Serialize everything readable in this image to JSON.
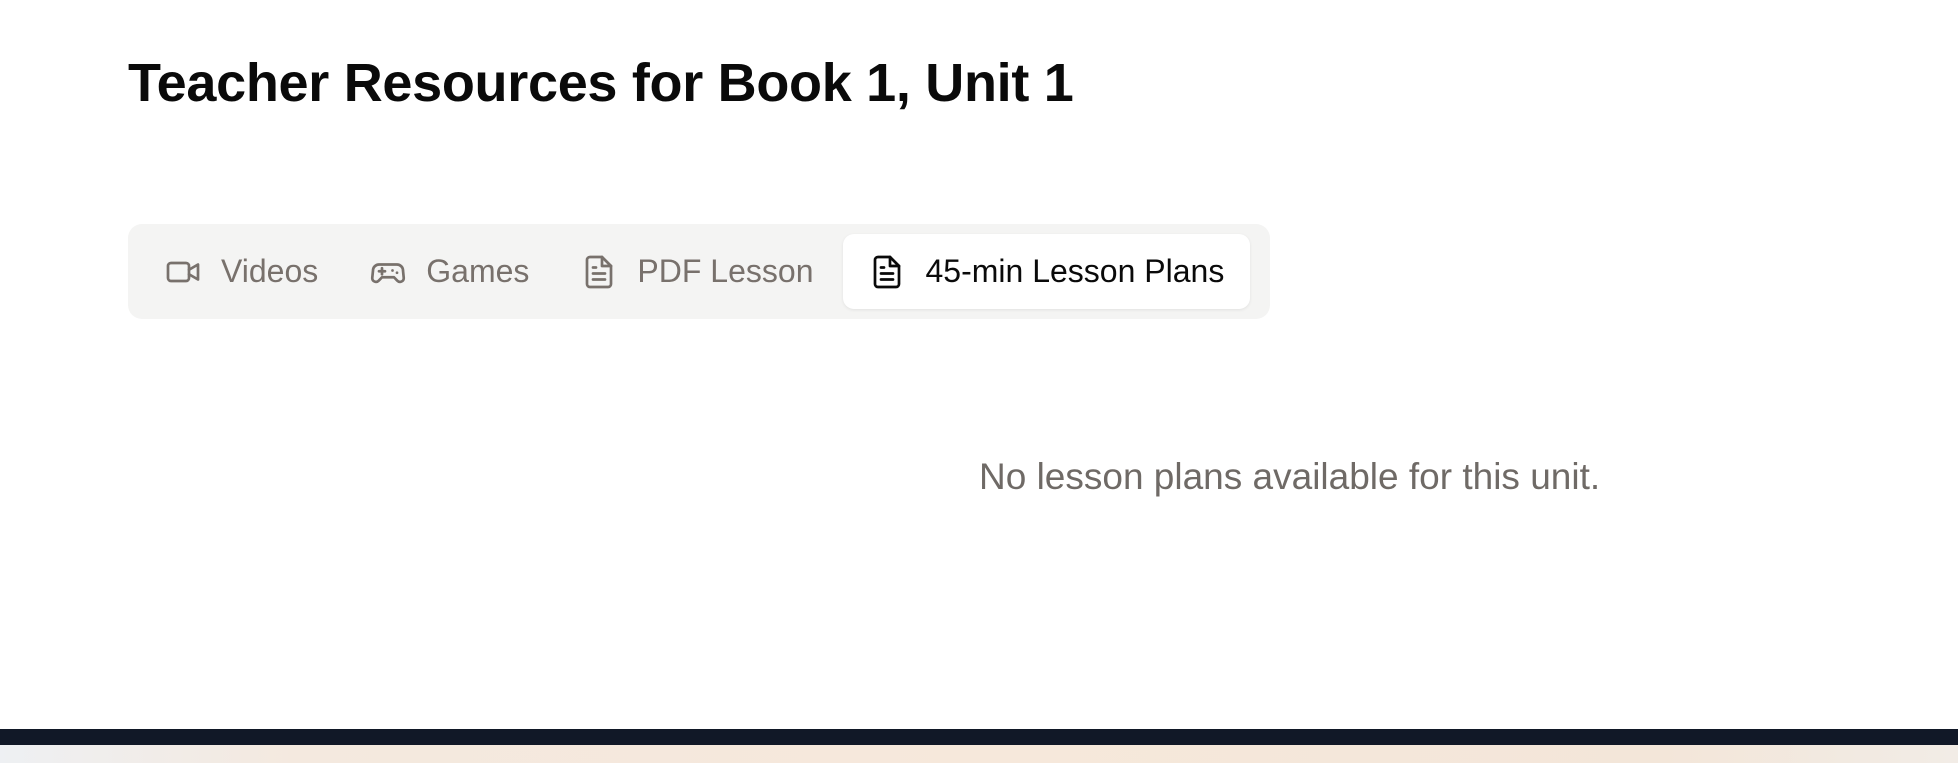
{
  "page": {
    "title": "Teacher Resources for Book 1, Unit 1"
  },
  "tabs": [
    {
      "label": "Videos",
      "icon": "video-icon",
      "active": false
    },
    {
      "label": "Games",
      "icon": "gamepad-icon",
      "active": false
    },
    {
      "label": "PDF Lesson",
      "icon": "document-icon",
      "active": false
    },
    {
      "label": "45-min Lesson Plans",
      "icon": "document-text-icon",
      "active": true
    }
  ],
  "content": {
    "empty_message": "No lesson plans available for this unit."
  },
  "colors": {
    "tab_bar_bg": "#f4f4f3",
    "tab_inactive_text": "#78716c",
    "tab_active_text": "#0a0a0a",
    "footer_bar": "#111827"
  }
}
